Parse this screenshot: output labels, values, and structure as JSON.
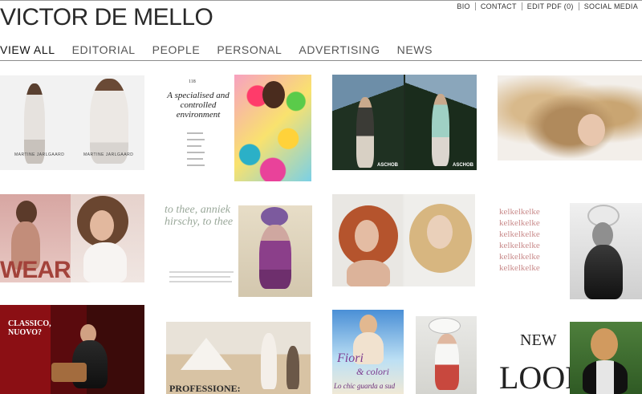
{
  "site": {
    "logo": "VICTOR DE MELLO"
  },
  "utility_nav": {
    "bio": "BIO",
    "contact": "CONTACT",
    "edit_pdf": "EDIT PDF (0)",
    "social_media": "SOCIAL MEDIA"
  },
  "main_nav": {
    "items": [
      {
        "label": "VIEW ALL",
        "active": true
      },
      {
        "label": "EDITORIAL",
        "active": false
      },
      {
        "label": "PEOPLE",
        "active": false
      },
      {
        "label": "PERSONAL",
        "active": false
      },
      {
        "label": "ADVERTISING",
        "active": false
      },
      {
        "label": "NEWS",
        "active": false
      }
    ]
  },
  "thumbnails": {
    "t1": {
      "caption_left": "MARTINE JARLGAARD",
      "caption_right": "MARTINE JARLGAARD"
    },
    "t2": {
      "issue": "118",
      "headline": "A specialised and controlled environment"
    },
    "t3": {
      "brand_left": "ASCHOB",
      "brand_right": "ASCHOB"
    },
    "t4": {},
    "t5": {
      "word": "WEAR"
    },
    "t6": {
      "script": "to thee, anniek hirschy, to thee"
    },
    "t7": {},
    "t8": {
      "repeat_text": "kelkelkelke"
    },
    "t9": {
      "headline": "CLASSICO, NUOVO?"
    },
    "t10": {
      "headline": "PROFESSIONE:"
    },
    "t11": {
      "script_a": "Fiori",
      "script_b": "& colori",
      "subline": "Lo chic guarda a sud"
    },
    "t12": {
      "word_a": "NEW",
      "word_b": "LOOK"
    }
  },
  "colors": {
    "accent_text": "#222222",
    "nav_text": "#555555",
    "rule": "#8c8c8c"
  }
}
